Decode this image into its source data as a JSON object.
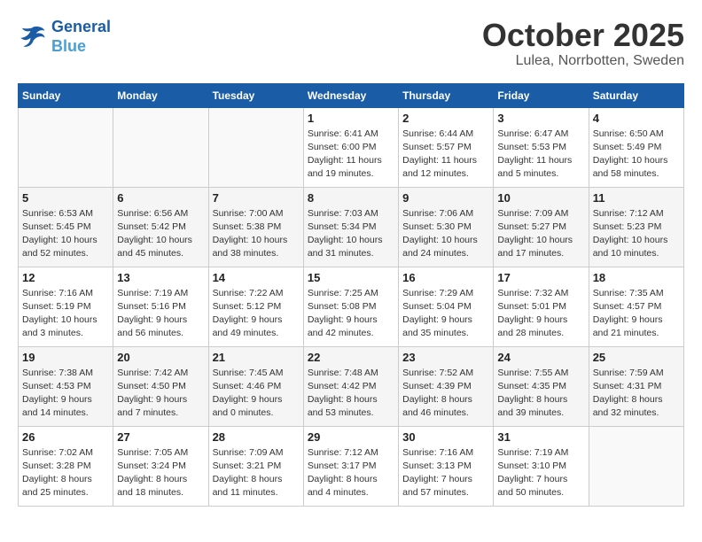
{
  "header": {
    "logo_line1": "General",
    "logo_line2": "Blue",
    "month": "October 2025",
    "location": "Lulea, Norrbotten, Sweden"
  },
  "weekdays": [
    "Sunday",
    "Monday",
    "Tuesday",
    "Wednesday",
    "Thursday",
    "Friday",
    "Saturday"
  ],
  "weeks": [
    [
      {
        "day": "",
        "info": ""
      },
      {
        "day": "",
        "info": ""
      },
      {
        "day": "",
        "info": ""
      },
      {
        "day": "1",
        "info": "Sunrise: 6:41 AM\nSunset: 6:00 PM\nDaylight: 11 hours\nand 19 minutes."
      },
      {
        "day": "2",
        "info": "Sunrise: 6:44 AM\nSunset: 5:57 PM\nDaylight: 11 hours\nand 12 minutes."
      },
      {
        "day": "3",
        "info": "Sunrise: 6:47 AM\nSunset: 5:53 PM\nDaylight: 11 hours\nand 5 minutes."
      },
      {
        "day": "4",
        "info": "Sunrise: 6:50 AM\nSunset: 5:49 PM\nDaylight: 10 hours\nand 58 minutes."
      }
    ],
    [
      {
        "day": "5",
        "info": "Sunrise: 6:53 AM\nSunset: 5:45 PM\nDaylight: 10 hours\nand 52 minutes."
      },
      {
        "day": "6",
        "info": "Sunrise: 6:56 AM\nSunset: 5:42 PM\nDaylight: 10 hours\nand 45 minutes."
      },
      {
        "day": "7",
        "info": "Sunrise: 7:00 AM\nSunset: 5:38 PM\nDaylight: 10 hours\nand 38 minutes."
      },
      {
        "day": "8",
        "info": "Sunrise: 7:03 AM\nSunset: 5:34 PM\nDaylight: 10 hours\nand 31 minutes."
      },
      {
        "day": "9",
        "info": "Sunrise: 7:06 AM\nSunset: 5:30 PM\nDaylight: 10 hours\nand 24 minutes."
      },
      {
        "day": "10",
        "info": "Sunrise: 7:09 AM\nSunset: 5:27 PM\nDaylight: 10 hours\nand 17 minutes."
      },
      {
        "day": "11",
        "info": "Sunrise: 7:12 AM\nSunset: 5:23 PM\nDaylight: 10 hours\nand 10 minutes."
      }
    ],
    [
      {
        "day": "12",
        "info": "Sunrise: 7:16 AM\nSunset: 5:19 PM\nDaylight: 10 hours\nand 3 minutes."
      },
      {
        "day": "13",
        "info": "Sunrise: 7:19 AM\nSunset: 5:16 PM\nDaylight: 9 hours\nand 56 minutes."
      },
      {
        "day": "14",
        "info": "Sunrise: 7:22 AM\nSunset: 5:12 PM\nDaylight: 9 hours\nand 49 minutes."
      },
      {
        "day": "15",
        "info": "Sunrise: 7:25 AM\nSunset: 5:08 PM\nDaylight: 9 hours\nand 42 minutes."
      },
      {
        "day": "16",
        "info": "Sunrise: 7:29 AM\nSunset: 5:04 PM\nDaylight: 9 hours\nand 35 minutes."
      },
      {
        "day": "17",
        "info": "Sunrise: 7:32 AM\nSunset: 5:01 PM\nDaylight: 9 hours\nand 28 minutes."
      },
      {
        "day": "18",
        "info": "Sunrise: 7:35 AM\nSunset: 4:57 PM\nDaylight: 9 hours\nand 21 minutes."
      }
    ],
    [
      {
        "day": "19",
        "info": "Sunrise: 7:38 AM\nSunset: 4:53 PM\nDaylight: 9 hours\nand 14 minutes."
      },
      {
        "day": "20",
        "info": "Sunrise: 7:42 AM\nSunset: 4:50 PM\nDaylight: 9 hours\nand 7 minutes."
      },
      {
        "day": "21",
        "info": "Sunrise: 7:45 AM\nSunset: 4:46 PM\nDaylight: 9 hours\nand 0 minutes."
      },
      {
        "day": "22",
        "info": "Sunrise: 7:48 AM\nSunset: 4:42 PM\nDaylight: 8 hours\nand 53 minutes."
      },
      {
        "day": "23",
        "info": "Sunrise: 7:52 AM\nSunset: 4:39 PM\nDaylight: 8 hours\nand 46 minutes."
      },
      {
        "day": "24",
        "info": "Sunrise: 7:55 AM\nSunset: 4:35 PM\nDaylight: 8 hours\nand 39 minutes."
      },
      {
        "day": "25",
        "info": "Sunrise: 7:59 AM\nSunset: 4:31 PM\nDaylight: 8 hours\nand 32 minutes."
      }
    ],
    [
      {
        "day": "26",
        "info": "Sunrise: 7:02 AM\nSunset: 3:28 PM\nDaylight: 8 hours\nand 25 minutes."
      },
      {
        "day": "27",
        "info": "Sunrise: 7:05 AM\nSunset: 3:24 PM\nDaylight: 8 hours\nand 18 minutes."
      },
      {
        "day": "28",
        "info": "Sunrise: 7:09 AM\nSunset: 3:21 PM\nDaylight: 8 hours\nand 11 minutes."
      },
      {
        "day": "29",
        "info": "Sunrise: 7:12 AM\nSunset: 3:17 PM\nDaylight: 8 hours\nand 4 minutes."
      },
      {
        "day": "30",
        "info": "Sunrise: 7:16 AM\nSunset: 3:13 PM\nDaylight: 7 hours\nand 57 minutes."
      },
      {
        "day": "31",
        "info": "Sunrise: 7:19 AM\nSunset: 3:10 PM\nDaylight: 7 hours\nand 50 minutes."
      },
      {
        "day": "",
        "info": ""
      }
    ]
  ]
}
